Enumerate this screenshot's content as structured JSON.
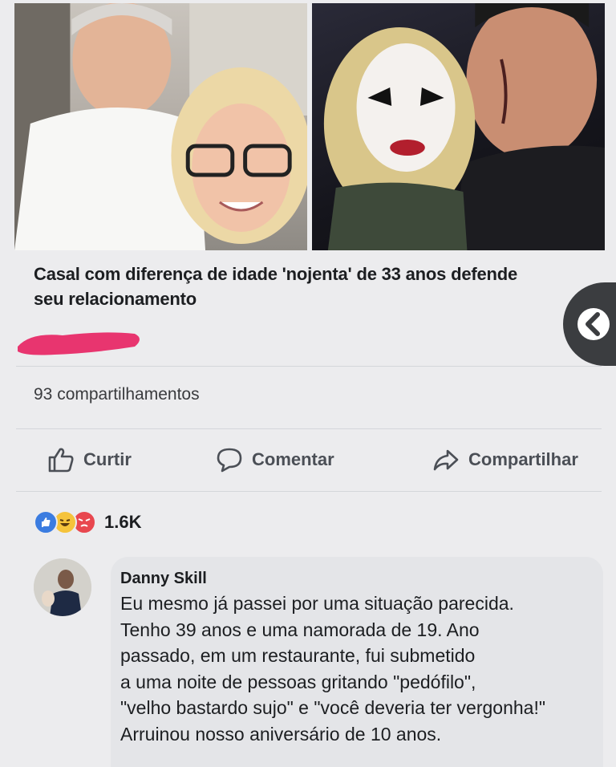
{
  "post": {
    "headline": "Casal com diferença de idade 'nojenta' de 33 anos defende seu relacionamento",
    "shares": "93 compartilhamentos"
  },
  "actions": {
    "like": "Curtir",
    "comment": "Comentar",
    "share": "Compartilhar"
  },
  "reactions": {
    "types": [
      "like",
      "haha",
      "angry"
    ],
    "count": "1.6K"
  },
  "comment": {
    "author": "Danny Skill",
    "lines": [
      "Eu mesmo já passei por uma situação parecida.",
      "Tenho 39 anos e uma namorada de 19. Ano",
      "passado, em um restaurante, fui submetido",
      "a uma noite de pessoas gritando \"pedófilo\",",
      "\"velho bastardo sujo\" e \"você deveria ter vergonha!\"",
      "Arruinou nosso aniversário de 10 anos."
    ]
  },
  "colors": {
    "like_blue": "#3b7ce0",
    "haha_yellow": "#f5c33b",
    "angry_red": "#e8474f",
    "scribble_pink": "#e8356f"
  }
}
